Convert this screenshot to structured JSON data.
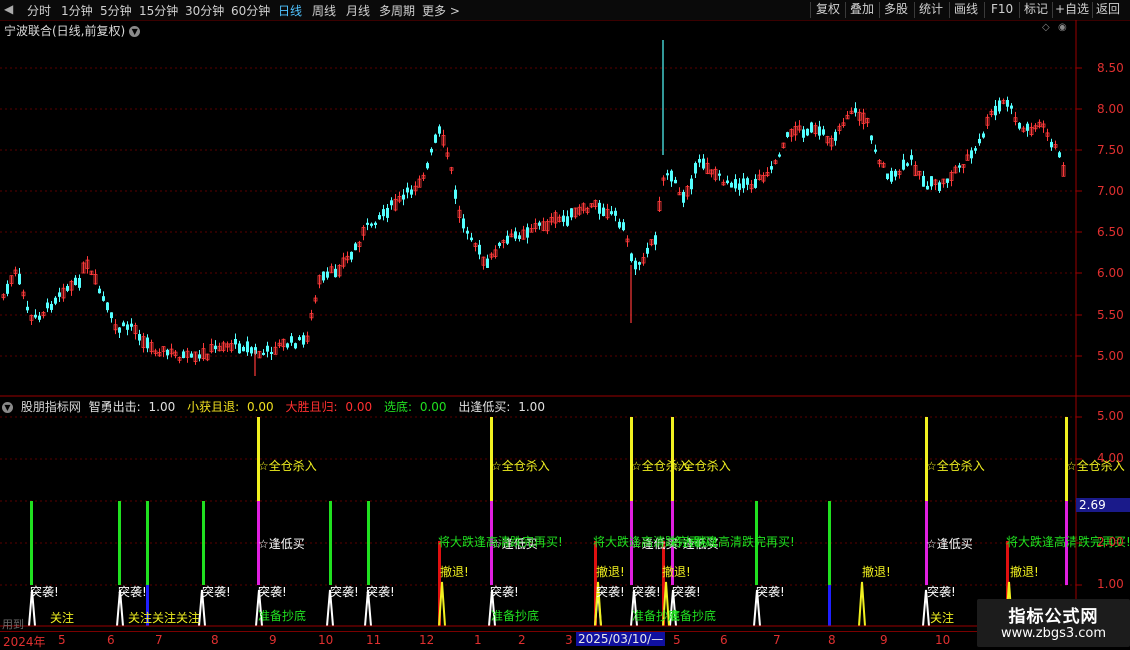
{
  "toolbar": {
    "periods": [
      {
        "label": "分时",
        "active": false
      },
      {
        "label": "1分钟",
        "active": false
      },
      {
        "label": "5分钟",
        "active": false
      },
      {
        "label": "15分钟",
        "active": false
      },
      {
        "label": "30分钟",
        "active": false
      },
      {
        "label": "60分钟",
        "active": false
      },
      {
        "label": "日线",
        "active": true
      },
      {
        "label": "周线",
        "active": false
      },
      {
        "label": "月线",
        "active": false
      },
      {
        "label": "多周期",
        "active": false
      }
    ],
    "more_label": "更多",
    "right_buttons": [
      "复权",
      "叠加",
      "多股",
      "统计",
      "画线",
      "F10",
      "标记",
      "+自选",
      "返回"
    ]
  },
  "left_arrow": "◀",
  "price_panel": {
    "title": "宁波联合(日线,前复权)",
    "y_axis": [
      "8.50",
      "8.00",
      "7.50",
      "7.00",
      "6.50",
      "6.00",
      "5.50",
      "5.00"
    ]
  },
  "indicator": {
    "name": "股朋指标网",
    "fields": [
      {
        "label": "智勇出击:",
        "value": "1.00",
        "color": "#e0e0e0"
      },
      {
        "label": "小获且退:",
        "value": "0.00",
        "color": "#f0e020"
      },
      {
        "label": "大胜且归:",
        "value": "0.00",
        "color": "#ff3030"
      },
      {
        "label": "选底:",
        "value": "0.00",
        "color": "#20e020"
      },
      {
        "label": "出逢低买:",
        "value": "1.00",
        "color": "#e0e0e0"
      }
    ],
    "y_axis": [
      "5.00",
      "4.00",
      "3.00",
      "2.00",
      "1.00"
    ],
    "cursor_value": "2.69",
    "signals": {
      "qc": "☆全仓杀入",
      "fd": "☆逢低买",
      "tx": "突袭!",
      "ct": "撤退!",
      "gz": "关注",
      "gzgz": "关注关注",
      "zb": "准备抄底",
      "jd": "将大跌逢高清跌完再买!"
    }
  },
  "date_axis": {
    "labels": [
      "2024年",
      "5",
      "6",
      "7",
      "8",
      "9",
      "10",
      "11",
      "12",
      "1",
      "2",
      "3",
      "5",
      "6",
      "7",
      "8",
      "9",
      "10"
    ],
    "cursor": "2025/03/10/—"
  },
  "hint": "用到",
  "watermark": {
    "title": "指标公式网",
    "url": "www.zbgs3.com"
  }
}
